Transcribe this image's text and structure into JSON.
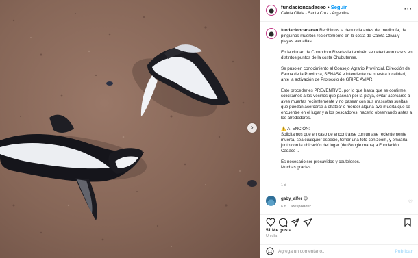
{
  "post": {
    "username": "fundacioncadaceo",
    "separator": "•",
    "follow_label": "Seguir",
    "location": "Caleta Olivia - Santa Cruz - Argentina",
    "more_icon": "more-horizontal-icon"
  },
  "caption": {
    "username": "fundacioncadaceo",
    "paragraphs": [
      "Recibimos la denuncia antes del mediodía, de pingüinos muertos recientemente en la costa de Caleta Olivia y playas aledañas.",
      "En la ciudad de Comodoro Rivadavia también se detectaron casos en distintos puntos de la costa Chubutense.",
      "Se puso en conocimiento al Consejo Agrario Provincial, Dirección de Fauna de la Provincia, SENASA e intendente de nuestra localidad, ante la activación de Protocolo de GRIPE AVIAR.",
      "Este proceder es PREVENTIVO, por lo que hasta que se confirme, solicitamos a los vecinos que pasean por la playa, evitar acercarse a aves muertas recientemente y no pasear con sus mascotas sueltas, que puedan acercarse a olfatear o morder alguna ave muerta que se encuentre en el lugar y a los pescadores, hacerlo observando antes a los alrededores.",
      "⚠️ ATENCIÓN:\nSolicitamos que en caso de encontrarse con un ave recientemente muerta, sea cualquier especie, tomar una foto con zoom, y enviarla junto con la ubicación del lugar (de Google maps) a Fundación Cadace ..",
      "Es necesario ser precavidos y cautelosos.\nMuchas gracias"
    ],
    "time": "1 d"
  },
  "comment": {
    "username": "gaby_alfer",
    "emoji": "😉",
    "time": "6 h",
    "reply_label": "Responder"
  },
  "actions": {
    "icons": [
      "heart-icon",
      "comment-icon",
      "share-icon",
      "bookmark-icon"
    ],
    "likes": "51 Me gusta",
    "date": "Un día"
  },
  "comment_box": {
    "placeholder": "Agrega un comentario...",
    "post_label": "Publicar"
  },
  "colors": {
    "accent": "#0095f6",
    "post_disabled": "#b2dffc",
    "muted": "#8e8e8e",
    "sand": "#866657"
  }
}
